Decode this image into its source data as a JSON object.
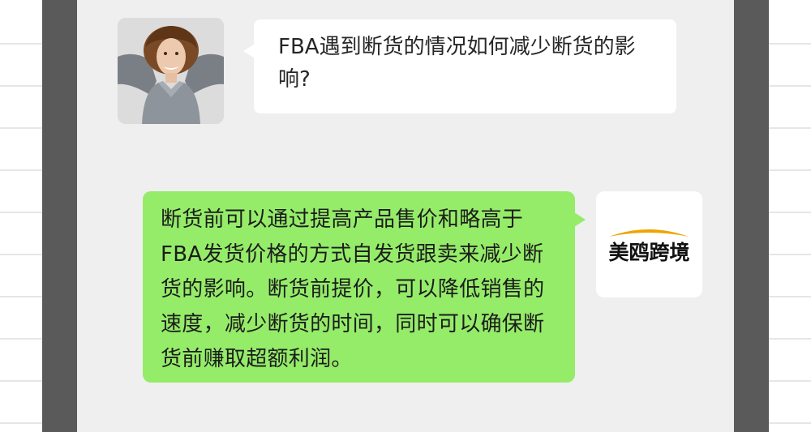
{
  "chat": {
    "incoming": {
      "text": "FBA遇到断货的情况如何减少断货的影响?",
      "avatar_icon": "woman-portrait-avatar"
    },
    "outgoing": {
      "text": "断货前可以通过提高产品售价和略高于FBA发货价格的方式自发货跟卖来减少断货的影响。断货前提价，可以降低销售的速度，减少断货的时间，同时可以确保断货前赚取超额利润。",
      "avatar": {
        "brand_name": "美鸥跨境",
        "arc_color": "#f0a400"
      }
    }
  },
  "colors": {
    "outgoing_bubble": "#95ec69",
    "incoming_bubble": "#ffffff",
    "chat_background": "#efefef",
    "frame": "#5a5a5a"
  }
}
